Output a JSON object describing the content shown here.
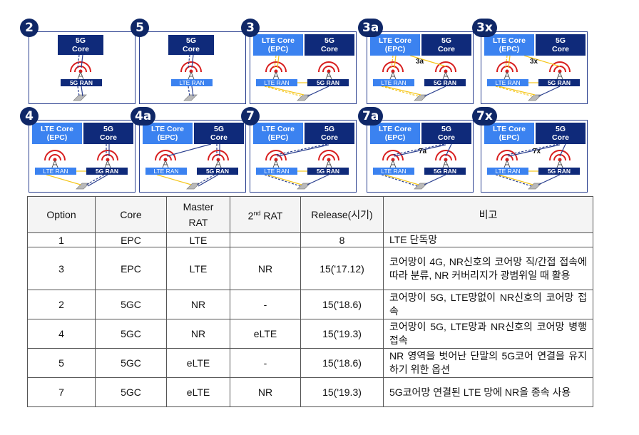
{
  "diagram": {
    "options": [
      {
        "id": "2",
        "cores": [
          {
            "type": "5g",
            "label": "5G\nCore"
          }
        ],
        "rans": [
          {
            "type": "5g",
            "label": "5G RAN"
          }
        ]
      },
      {
        "id": "5",
        "cores": [
          {
            "type": "5g",
            "label": "5G\nCore"
          }
        ],
        "rans": [
          {
            "type": "lte",
            "label": "LTE RAN"
          }
        ]
      },
      {
        "id": "3",
        "cores": [
          {
            "type": "lte",
            "label": "LTE Core\n(EPC)"
          },
          {
            "type": "5g",
            "label": "5G\nCore"
          }
        ],
        "rans": [
          {
            "type": "lte",
            "label": "LTE RAN"
          },
          {
            "type": "5g",
            "label": "5G RAN"
          }
        ]
      },
      {
        "id": "3a",
        "cores": [
          {
            "type": "lte",
            "label": "LTE Core\n(EPC)"
          },
          {
            "type": "5g",
            "label": "5G\nCore"
          }
        ],
        "rans": [
          {
            "type": "lte",
            "label": "LTE RAN"
          },
          {
            "type": "5g",
            "label": "5G RAN"
          }
        ],
        "link_label": "3a"
      },
      {
        "id": "3x",
        "cores": [
          {
            "type": "lte",
            "label": "LTE Core\n(EPC)"
          },
          {
            "type": "5g",
            "label": "5G\nCore"
          }
        ],
        "rans": [
          {
            "type": "lte",
            "label": "LTE RAN"
          },
          {
            "type": "5g",
            "label": "5G RAN"
          }
        ],
        "link_label": "3x"
      },
      {
        "id": "4",
        "cores": [
          {
            "type": "lte",
            "label": "LTE Core\n(EPC)"
          },
          {
            "type": "5g",
            "label": "5G\nCore"
          }
        ],
        "rans": [
          {
            "type": "lte",
            "label": "LTE RAN"
          },
          {
            "type": "5g",
            "label": "5G RAN"
          }
        ]
      },
      {
        "id": "4a",
        "cores": [
          {
            "type": "lte",
            "label": "LTE Core\n(EPC)"
          },
          {
            "type": "5g",
            "label": "5G\nCore"
          }
        ],
        "rans": [
          {
            "type": "lte",
            "label": "LTE RAN"
          },
          {
            "type": "5g",
            "label": "5G RAN"
          }
        ]
      },
      {
        "id": "7",
        "cores": [
          {
            "type": "lte",
            "label": "LTE Core\n(EPC)"
          },
          {
            "type": "5g",
            "label": "5G\nCore"
          }
        ],
        "rans": [
          {
            "type": "lte",
            "label": "LTE RAN"
          },
          {
            "type": "5g",
            "label": "5G RAN"
          }
        ]
      },
      {
        "id": "7a",
        "cores": [
          {
            "type": "lte",
            "label": "LTE Core\n(EPC)"
          },
          {
            "type": "5g",
            "label": "5G\nCore"
          }
        ],
        "rans": [
          {
            "type": "lte",
            "label": "LTE RAN"
          },
          {
            "type": "5g",
            "label": "5G RAN"
          }
        ],
        "link_label": "7a"
      },
      {
        "id": "7x",
        "cores": [
          {
            "type": "lte",
            "label": "LTE Core\n(EPC)"
          },
          {
            "type": "5g",
            "label": "5G\nCore"
          }
        ],
        "rans": [
          {
            "type": "lte",
            "label": "LTE RAN"
          },
          {
            "type": "5g",
            "label": "5G RAN"
          }
        ],
        "link_label": "7x"
      }
    ],
    "colors": {
      "badge": "#0f2767",
      "core_5g": "#0f2a7a",
      "core_lte": "#3b82f0",
      "control_link": "#f5c518",
      "user_link": "#2a3f8f",
      "antenna": "#d81e1e"
    }
  },
  "table": {
    "headers": {
      "option": "Option",
      "core": "Core",
      "master_rat": "Master\nRAT",
      "second_rat_num": "2",
      "second_rat_sup": "nd",
      "second_rat_text": " RAT",
      "release": "Release(시기)",
      "note": "비고"
    },
    "rows": [
      {
        "option": "1",
        "core": "EPC",
        "master_rat": "LTE",
        "second_rat": "",
        "release": "8",
        "note": "LTE 단독망"
      },
      {
        "option": "3",
        "core": "EPC",
        "master_rat": "LTE",
        "second_rat": "NR",
        "release": "15('17.12)",
        "note": "코어망이 4G, NR신호의 코어망 직/간접 접속에 따라 분류, NR 커버리지가 광범위일 때 활용"
      },
      {
        "option": "2",
        "core": "5GC",
        "master_rat": "NR",
        "second_rat": "-",
        "release": "15('18.6)",
        "note": "코어망이 5G, LTE망없이 NR신호의 코어망 접속"
      },
      {
        "option": "4",
        "core": "5GC",
        "master_rat": "NR",
        "second_rat": "eLTE",
        "release": "15('19.3)",
        "note": "코어망이 5G, LTE망과 NR신호의 코어망 병행 접속"
      },
      {
        "option": "5",
        "core": "5GC",
        "master_rat": "eLTE",
        "second_rat": "-",
        "release": "15('18.6)",
        "note": "NR 영역을 벗어난 단말의 5G코어 연결을 유지하기 위한 옵션"
      },
      {
        "option": "7",
        "core": "5GC",
        "master_rat": "eLTE",
        "second_rat": "NR",
        "release": "15('19.3)",
        "note": "5G코어망 연결된 LTE 망에 NR을 종속 사용"
      }
    ]
  }
}
